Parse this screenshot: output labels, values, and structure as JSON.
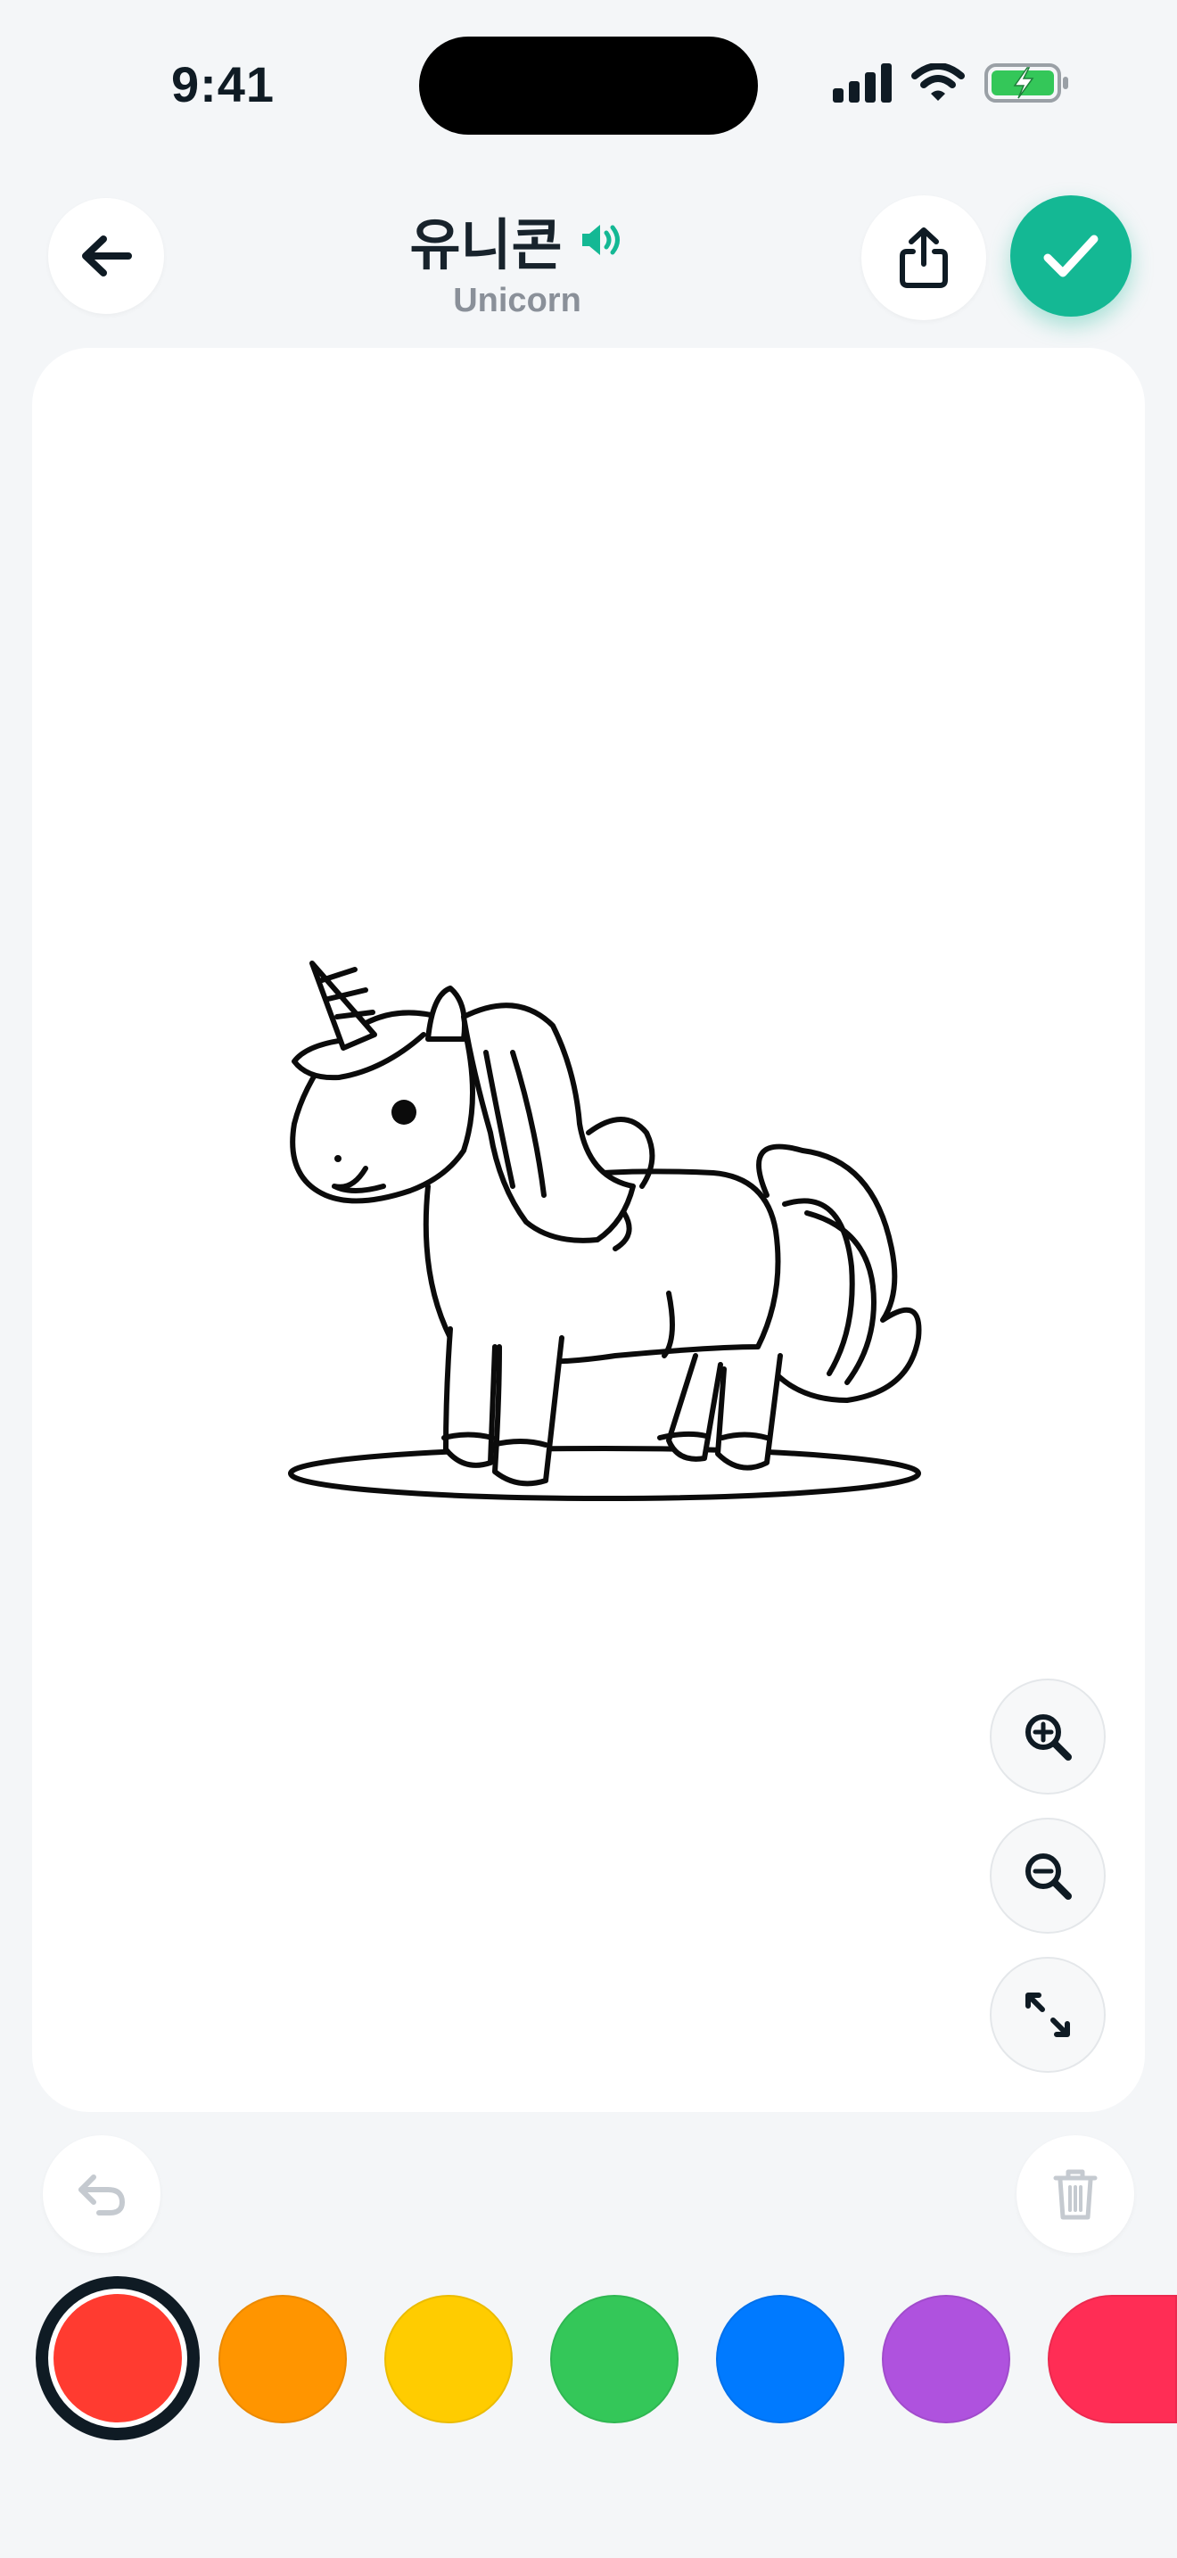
{
  "status_bar": {
    "time": "9:41"
  },
  "header": {
    "title": "유니콘",
    "subtitle": "Unicorn"
  },
  "icons": {
    "back": "arrow-left-icon",
    "speaker": "speaker-icon",
    "share": "share-icon",
    "done": "checkmark-icon",
    "zoom_in": "zoom-in-icon",
    "zoom_out": "zoom-out-icon",
    "fit": "fit-screen-icon",
    "undo": "undo-icon",
    "trash": "trash-icon"
  },
  "colors": {
    "accent": "#14B894",
    "background": "#F4F6F8",
    "canvas": "#FFFFFF"
  },
  "palette": [
    {
      "name": "red",
      "color": "#FF3B30",
      "selected": true
    },
    {
      "name": "orange",
      "color": "#FF9500",
      "selected": false
    },
    {
      "name": "yellow",
      "color": "#FFCC00",
      "selected": false
    },
    {
      "name": "green",
      "color": "#34C759",
      "selected": false
    },
    {
      "name": "blue",
      "color": "#007AFF",
      "selected": false
    },
    {
      "name": "purple",
      "color": "#AF52DE",
      "selected": false
    },
    {
      "name": "pink",
      "color": "#FF2D55",
      "selected": false
    }
  ],
  "undo_enabled": false,
  "delete_enabled": false
}
